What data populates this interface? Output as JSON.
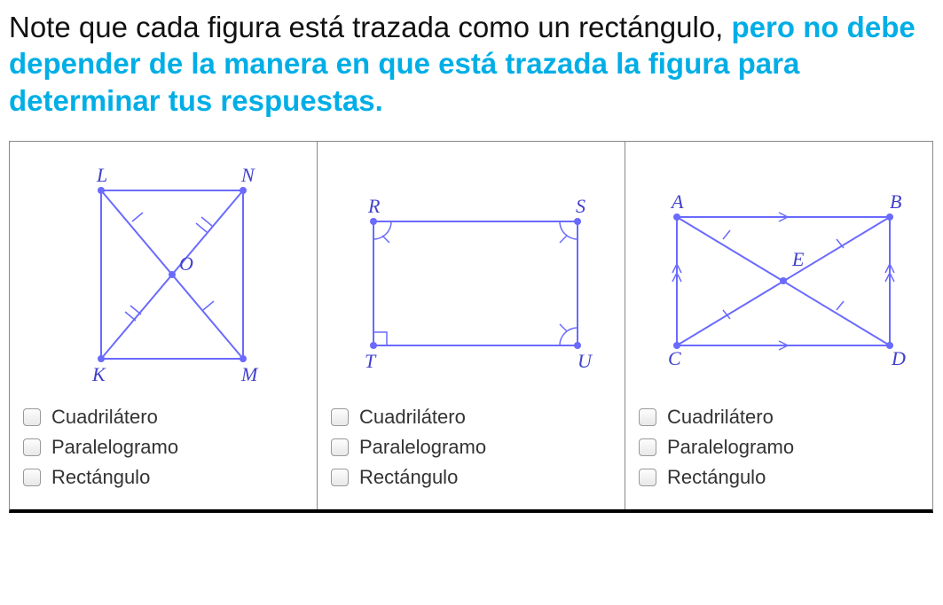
{
  "instruction": {
    "plain": "Note que cada figura está trazada como un rectángulo, ",
    "highlight": "pero no debe depender de la manera en que está trazada la figura para determinar tus respuestas."
  },
  "options": [
    "Cuadrilátero",
    "Paralelogramo",
    "Rectángulo"
  ],
  "figures": [
    {
      "id": "fig1",
      "vertices": {
        "topLeft": "L",
        "topRight": "N",
        "bottomLeft": "K",
        "bottomRight": "M",
        "center": "O"
      }
    },
    {
      "id": "fig2",
      "vertices": {
        "topLeft": "R",
        "topRight": "S",
        "bottomLeft": "T",
        "bottomRight": "U"
      }
    },
    {
      "id": "fig3",
      "vertices": {
        "topLeft": "A",
        "topRight": "B",
        "bottomLeft": "C",
        "bottomRight": "D",
        "center": "E"
      }
    }
  ]
}
